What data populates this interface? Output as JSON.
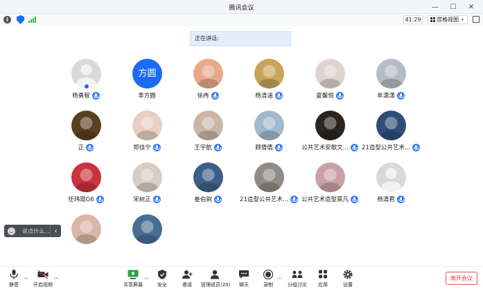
{
  "window": {
    "title": "腾讯会议",
    "controls": [
      "—",
      "☐",
      "✕"
    ]
  },
  "infobar": {
    "timer": "41:29",
    "view_label": "宫格视图"
  },
  "speaking": {
    "label": "正在讲话:"
  },
  "participants": [
    {
      "name": "杨勇智",
      "avatar": "gray-person"
    },
    {
      "name": "李方圆",
      "avatar": "text",
      "avatar_text": "方圆",
      "avatar_color": "#1c6bf2"
    },
    {
      "name": "徐冉",
      "avatar": "photo",
      "tone": "#e8a98b"
    },
    {
      "name": "杨清涵",
      "avatar": "photo",
      "tone": "#c9a45b"
    },
    {
      "name": "夏馨悦",
      "avatar": "photo",
      "tone": "#ddd4d0"
    },
    {
      "name": "牟潇潇",
      "avatar": "photo",
      "tone": "#b7bcc4"
    },
    {
      "name": "正",
      "avatar": "photo",
      "tone": "#5a3f22"
    },
    {
      "name": "郑佳宁",
      "avatar": "photo",
      "tone": "#e8d0c2"
    },
    {
      "name": "王宇航",
      "avatar": "photo",
      "tone": "#c8b7a7"
    },
    {
      "name": "顾倩倩",
      "avatar": "photo",
      "tone": "#9fb9cf"
    },
    {
      "name": "公共艺术安歇文...",
      "avatar": "photo",
      "tone": "#2b2420"
    },
    {
      "name": "21造型公共艺术...",
      "avatar": "photo",
      "tone": "#2f4d78"
    },
    {
      "name": "任玮琨G6",
      "avatar": "photo",
      "tone": "#c9333b"
    },
    {
      "name": "宋树正",
      "avatar": "photo",
      "tone": "#d8cdc5"
    },
    {
      "name": "姜伯驹",
      "avatar": "photo",
      "tone": "#3f5e86"
    },
    {
      "name": "21造型公共艺术...",
      "avatar": "photo",
      "tone": "#8f8b86"
    },
    {
      "name": "公共艺术造型莫凡",
      "avatar": "photo",
      "tone": "#c9a1a6"
    },
    {
      "name": "杨清君",
      "avatar": "gray-person"
    },
    {
      "name": "",
      "avatar": "photo",
      "tone": "#d9b6a8"
    },
    {
      "name": "",
      "avatar": "photo",
      "tone": "#4b6d94"
    }
  ],
  "chat": {
    "placeholder": "说点什么...",
    "collapse": "‹"
  },
  "toolbar": {
    "mute": "静音",
    "start_video": "开启视频",
    "share_screen": "共享屏幕",
    "security": "安全",
    "invite": "邀请",
    "manage_members": "管理成员(20)",
    "chat": "聊天",
    "record": "录制",
    "breakout": "分组讨论",
    "apps": "应用",
    "settings": "设置",
    "leave": "离开会议"
  },
  "colors": {
    "accent": "#1c6bf2",
    "leave": "#e03d3d",
    "speaking_bg": "#e3edfb"
  }
}
